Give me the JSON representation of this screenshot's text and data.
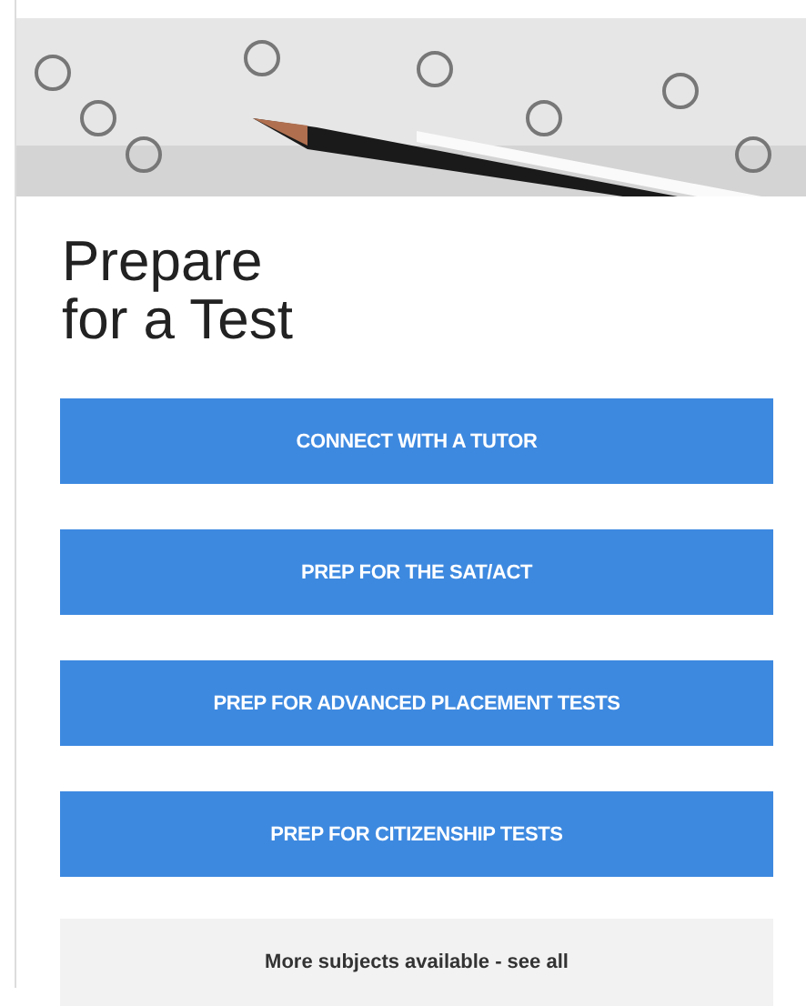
{
  "title": [
    "Prepare",
    "for a Test"
  ],
  "buttons": [
    {
      "label": "CONNECT WITH A TUTOR"
    },
    {
      "label": "PREP FOR THE SAT/ACT"
    },
    {
      "label": "PREP FOR ADVANCED PLACEMENT TESTS"
    },
    {
      "label": "PREP FOR CITIZENSHIP TESTS"
    }
  ],
  "more_link": "More subjects available - see all"
}
